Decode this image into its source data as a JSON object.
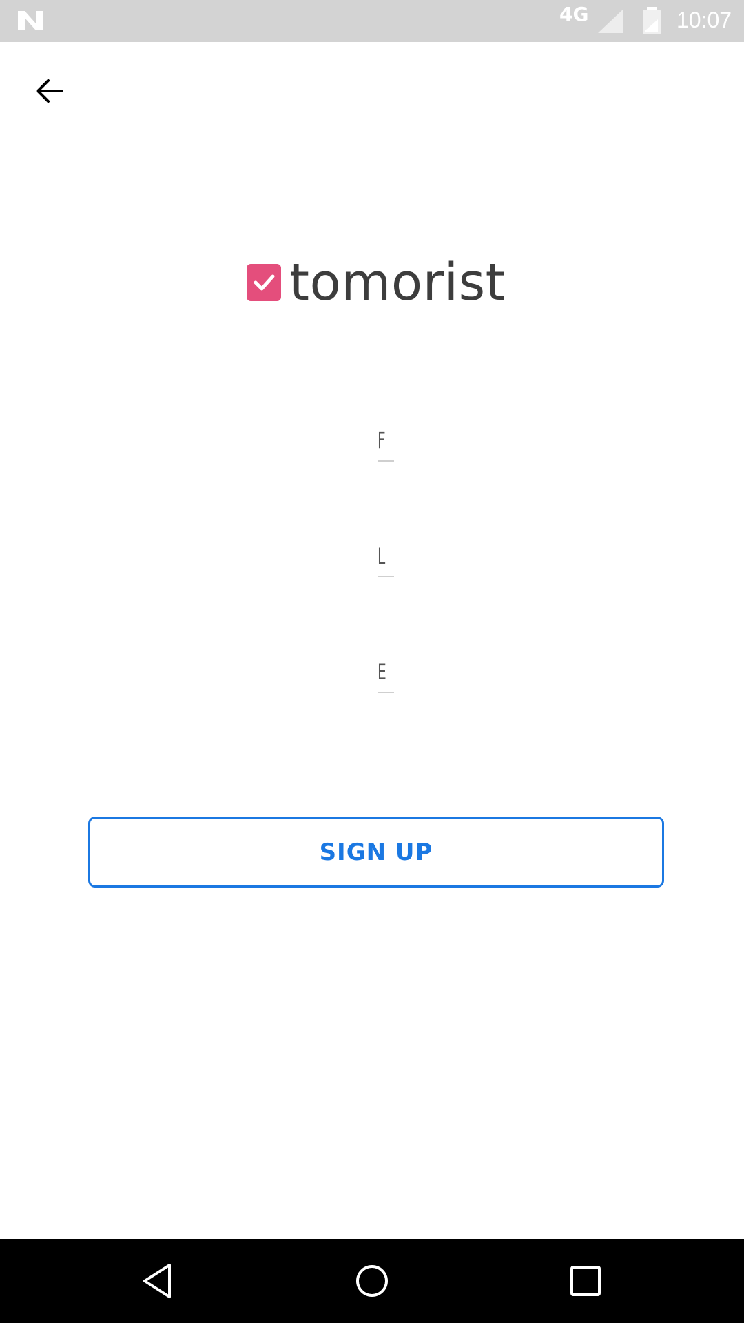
{
  "status_bar": {
    "network": "4G",
    "time": "10:07",
    "icons": [
      "notification-n-icon",
      "signal-icon",
      "battery-icon"
    ]
  },
  "header": {
    "back_icon": "arrow-left-icon"
  },
  "logo": {
    "text": "tomorist",
    "brand_color": "#e44e7c",
    "icon": "checkbox-checked-icon"
  },
  "form": {
    "first_name": {
      "label": "F"
    },
    "last_name": {
      "label": "L"
    },
    "email": {
      "label": "E"
    }
  },
  "signup_button": {
    "label": "SIGN UP",
    "color": "#1b78e2"
  },
  "nav_bar": {
    "icons": [
      "nav-back-icon",
      "nav-home-icon",
      "nav-recents-icon"
    ]
  }
}
